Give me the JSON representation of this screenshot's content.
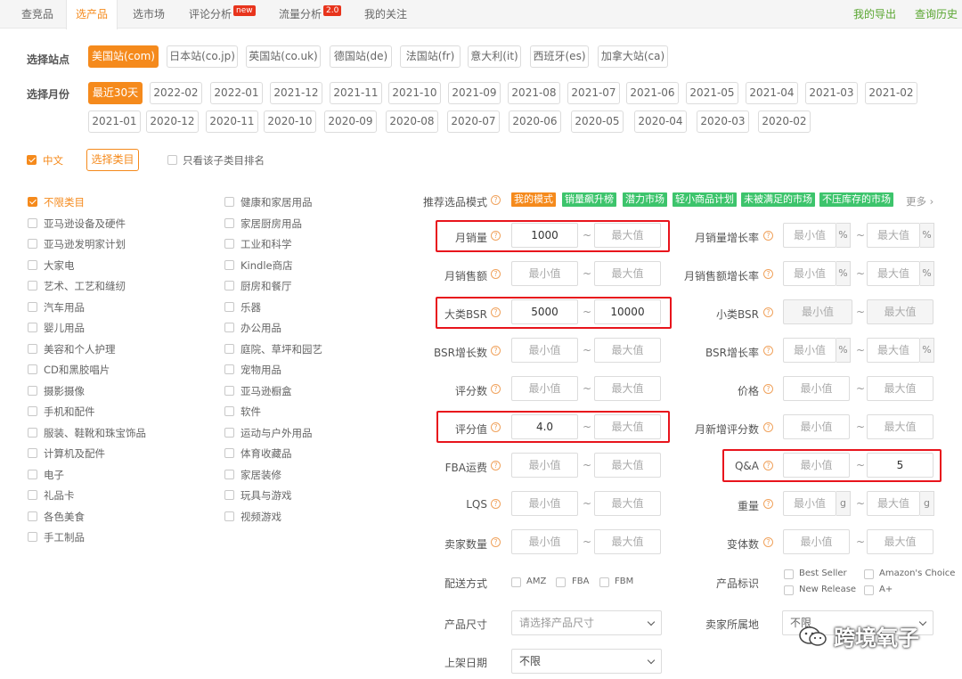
{
  "nav": {
    "tabs": [
      {
        "label": "查竞品"
      },
      {
        "label": "选产品"
      },
      {
        "label": "选市场"
      },
      {
        "label": "评论分析",
        "badge": "new"
      },
      {
        "label": "流量分析",
        "badge": "2.0"
      },
      {
        "label": "我的关注"
      }
    ],
    "my_export": "我的导出",
    "query_history": "查询历史"
  },
  "site": {
    "label": "选择站点",
    "options": [
      "美国站(com)",
      "日本站(co.jp)",
      "英国站(co.uk)",
      "德国站(de)",
      "法国站(fr)",
      "意大利(it)",
      "西班牙(es)",
      "加拿大站(ca)"
    ],
    "selected": "美国站(com)"
  },
  "month": {
    "label": "选择月份",
    "row1": [
      "最近30天",
      "2022-02",
      "2022-01",
      "2021-12",
      "2021-11",
      "2021-10",
      "2021-09",
      "2021-08",
      "2021-07",
      "2021-06",
      "2021-05",
      "2021-04",
      "2021-03",
      "2021-02"
    ],
    "row2": [
      "2021-01",
      "2020-12",
      "2020-11",
      "2020-10",
      "2020-09",
      "2020-08",
      "2020-07",
      "2020-06",
      "2020-05",
      "2020-04",
      "2020-03",
      "2020-02"
    ],
    "selected": "最近30天"
  },
  "category_bar": {
    "lang": "中文",
    "choose_category": "选择类目",
    "only_sub": "只看该子类目排名"
  },
  "categories_col1": [
    "不限类目",
    "亚马逊设备及硬件",
    "亚马逊发明家计划",
    "大家电",
    "艺术、工艺和缝纫",
    "汽车用品",
    "婴儿用品",
    "美容和个人护理",
    "CD和黑胶唱片",
    "摄影摄像",
    "手机和配件",
    "服装、鞋靴和珠宝饰品",
    "计算机及配件",
    "电子",
    "礼品卡",
    "各色美食",
    "手工制品"
  ],
  "categories_col2": [
    "健康和家居用品",
    "家居厨房用品",
    "工业和科学",
    "Kindle商店",
    "厨房和餐厅",
    "乐器",
    "办公用品",
    "庭院、草坪和园艺",
    "宠物用品",
    "亚马逊橱盒",
    "软件",
    "运动与户外用品",
    "体育收藏品",
    "家居装修",
    "玩具与游戏",
    "视频游戏"
  ],
  "mode": {
    "label": "推荐选品模式",
    "tags": [
      "我的模式",
      "销量飙升榜",
      "潜力市场",
      "轻小商品计划",
      "未被满足的市场",
      "不压库存的市场"
    ],
    "more": "更多"
  },
  "filters_left": [
    {
      "label": "月销量",
      "min": "1000",
      "max": "最大值",
      "min_set": true,
      "max_set": false
    },
    {
      "label": "月销售额",
      "min": "最小值",
      "max": "最大值"
    },
    {
      "label": "大类BSR",
      "min": "5000",
      "max": "10000",
      "min_set": true,
      "max_set": true
    },
    {
      "label": "BSR增长数",
      "min": "最小值",
      "max": "最大值"
    },
    {
      "label": "评分数",
      "min": "最小值",
      "max": "最大值"
    },
    {
      "label": "评分值",
      "min": "4.0",
      "max": "最大值",
      "min_set": true
    },
    {
      "label": "FBA运费",
      "min": "最小值",
      "max": "最大值"
    },
    {
      "label": "LQS",
      "min": "最小值",
      "max": "最大值"
    },
    {
      "label": "卖家数量",
      "min": "最小值",
      "max": "最大值"
    }
  ],
  "filters_right": [
    {
      "label": "月销量增长率",
      "min": "最小值",
      "max": "最大值",
      "unit": "%"
    },
    {
      "label": "月销售额增长率",
      "min": "最小值",
      "max": "最大值",
      "unit": "%"
    },
    {
      "label": "小类BSR",
      "min": "最小值",
      "max": "最大值"
    },
    {
      "label": "BSR增长率",
      "min": "最小值",
      "max": "最大值",
      "unit": "%"
    },
    {
      "label": "价格",
      "min": "最小值",
      "max": "最大值"
    },
    {
      "label": "月新增评分数",
      "min": "最小值",
      "max": "最大值"
    },
    {
      "label": "Q&A",
      "min": "最小值",
      "max": "5",
      "max_set": true
    },
    {
      "label": "重量",
      "min": "最小值",
      "max": "最大值",
      "unit": "g"
    },
    {
      "label": "变体数",
      "min": "最小值",
      "max": "最大值"
    }
  ],
  "delivery": {
    "label": "配送方式",
    "options": [
      "AMZ",
      "FBA",
      "FBM"
    ]
  },
  "product_flags": {
    "label": "产品标识",
    "options": [
      "Best Seller",
      "Amazon's Choice",
      "New Release",
      "A+"
    ]
  },
  "size": {
    "label": "产品尺寸",
    "placeholder": "请选择产品尺寸"
  },
  "seller_loc": {
    "label": "卖家所属地",
    "value": "不限"
  },
  "listing_date": {
    "label": "上架日期",
    "value": "不限"
  },
  "watermark": "跨境氧子",
  "colors": {
    "accent": "#f58a1c",
    "green": "#3dc46c",
    "red_box": "#e8141c",
    "badge_red": "#e8341c"
  }
}
